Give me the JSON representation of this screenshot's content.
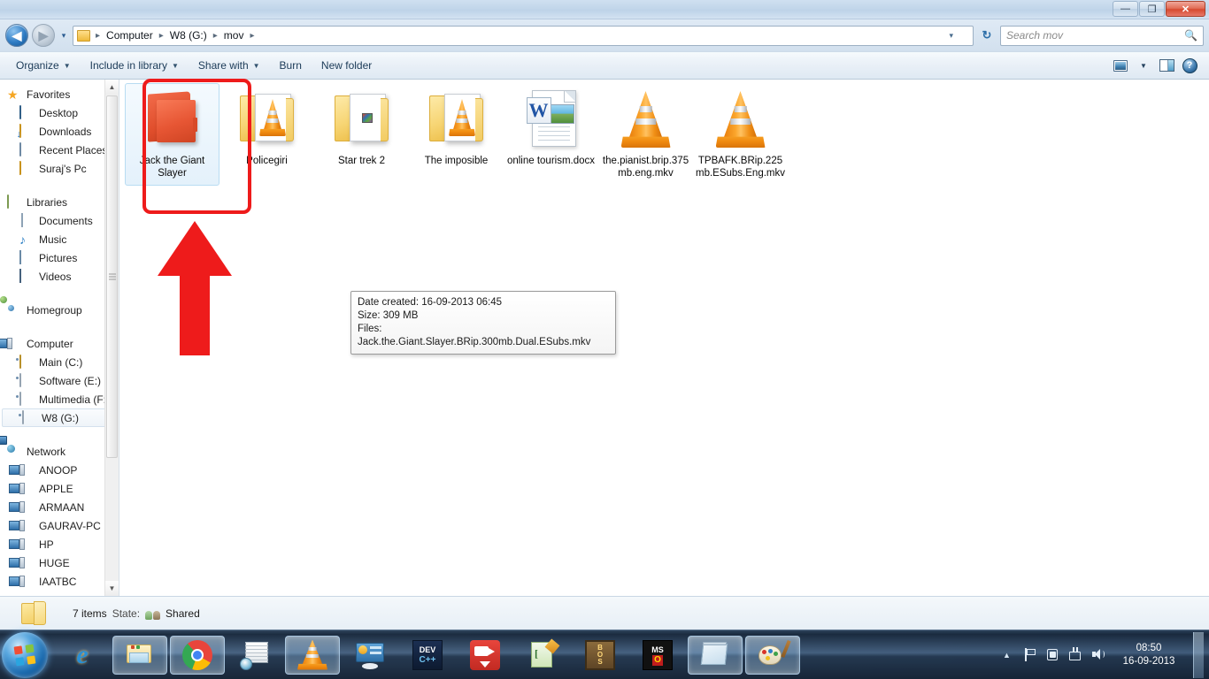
{
  "window": {
    "title": "",
    "buttons": {
      "minimize": "—",
      "maximize": "❐",
      "close": "✕"
    }
  },
  "address_bar": {
    "back_label": "◀",
    "forward_label": "▶",
    "recent_dropdown_label": "▾",
    "breadcrumb": [
      "Computer",
      "W8 (G:)",
      "mov"
    ],
    "separator": "▸",
    "dropdown_label": "▾",
    "refresh_label": "↻"
  },
  "search": {
    "placeholder": "Search mov",
    "value": "",
    "icon": "search-icon"
  },
  "command_bar": {
    "items": [
      {
        "label": "Organize",
        "has_caret": true
      },
      {
        "label": "Include in library",
        "has_caret": true
      },
      {
        "label": "Share with",
        "has_caret": true
      },
      {
        "label": "Burn",
        "has_caret": false
      },
      {
        "label": "New folder",
        "has_caret": false
      }
    ],
    "right_icons": [
      "change-view-icon",
      "chevron-down-icon",
      "preview-pane-icon",
      "help-icon"
    ]
  },
  "sidebar": {
    "groups": [
      {
        "header": {
          "label": "Favorites",
          "icon": "star-icon"
        },
        "items": [
          {
            "label": "Desktop",
            "icon": "desktop-icon"
          },
          {
            "label": "Downloads",
            "icon": "downloads-folder-icon"
          },
          {
            "label": "Recent Places",
            "icon": "recent-places-icon"
          },
          {
            "label": "Suraj's Pc",
            "icon": "user-folder-icon"
          }
        ]
      },
      {
        "header": {
          "label": "Libraries",
          "icon": "libraries-icon"
        },
        "items": [
          {
            "label": "Documents",
            "icon": "document-icon"
          },
          {
            "label": "Music",
            "icon": "music-note-icon"
          },
          {
            "label": "Pictures",
            "icon": "picture-icon"
          },
          {
            "label": "Videos",
            "icon": "video-icon"
          }
        ]
      },
      {
        "header": {
          "label": "Homegroup",
          "icon": "homegroup-icon"
        },
        "items": []
      },
      {
        "header": {
          "label": "Computer",
          "icon": "computer-icon"
        },
        "items": [
          {
            "label": "Main (C:)",
            "icon": "system-drive-icon",
            "selected": false
          },
          {
            "label": "Software (E:)",
            "icon": "drive-icon",
            "selected": false
          },
          {
            "label": "Multimedia (F:)",
            "icon": "drive-icon",
            "selected": false
          },
          {
            "label": "W8 (G:)",
            "icon": "drive-icon",
            "selected": true
          }
        ]
      },
      {
        "header": {
          "label": "Network",
          "icon": "network-icon"
        },
        "items": [
          {
            "label": "ANOOP",
            "icon": "network-computer-icon"
          },
          {
            "label": "APPLE",
            "icon": "network-computer-icon"
          },
          {
            "label": "ARMAAN",
            "icon": "network-computer-icon"
          },
          {
            "label": "GAURAV-PC",
            "icon": "network-computer-icon"
          },
          {
            "label": "HP",
            "icon": "network-computer-icon"
          },
          {
            "label": "HUGE",
            "icon": "network-computer-icon"
          },
          {
            "label": "IAATBC",
            "icon": "network-computer-icon"
          }
        ]
      }
    ],
    "scroll_up_label": "▲",
    "scroll_down_label": "▼"
  },
  "files": [
    {
      "name": "Jack the Giant Slayer",
      "type": "folder-red-open",
      "selected": true
    },
    {
      "name": "Policegiri",
      "type": "folder-vlc",
      "selected": false
    },
    {
      "name": "Star trek 2",
      "type": "folder-media",
      "selected": false
    },
    {
      "name": "The imposible",
      "type": "folder-vlc",
      "selected": false
    },
    {
      "name": "online tourism.docx",
      "type": "word-document",
      "selected": false
    },
    {
      "name": "the.pianist.brip.375mb.eng.mkv",
      "type": "vlc-video",
      "selected": false
    },
    {
      "name": "TPBAFK.BRip.225mb.ESubs.Eng.mkv",
      "type": "vlc-video",
      "selected": false
    }
  ],
  "tooltip": {
    "date_created": "Date created: 16-09-2013 06:45",
    "size": "Size: 309 MB",
    "files": "Files: Jack.the.Giant.Slayer.BRip.300mb.Dual.ESubs.mkv"
  },
  "status_bar": {
    "item_count": "7 items",
    "state_label": "State:",
    "state_value": "Shared",
    "icon": "shared-users-icon"
  },
  "annotations": {
    "highlight_color": "#ee1b1b",
    "highlight_target": "Jack the Giant Slayer",
    "arrow_direction": "up"
  },
  "taskbar": {
    "start_label": "Start",
    "buttons": [
      {
        "name": "internet-explorer",
        "active": false
      },
      {
        "name": "windows-explorer",
        "active": true
      },
      {
        "name": "google-chrome",
        "active": true
      },
      {
        "name": "nero-burning",
        "active": false
      },
      {
        "name": "vlc-media-player",
        "active": true
      },
      {
        "name": "control-panel",
        "active": false
      },
      {
        "name": "dev-cpp",
        "active": false
      },
      {
        "name": "video-recorder",
        "active": false
      },
      {
        "name": "text-editor",
        "active": false
      },
      {
        "name": "dosbox",
        "active": false
      },
      {
        "name": "ms-office",
        "active": false
      },
      {
        "name": "notepad",
        "active": true
      },
      {
        "name": "paint",
        "active": true
      }
    ],
    "tray_icons": [
      "show-hidden-icons",
      "action-center-flag",
      "network-icon",
      "removable-media-icon",
      "volume-icon"
    ],
    "clock": {
      "time": "08:50",
      "date": "16-09-2013"
    }
  }
}
